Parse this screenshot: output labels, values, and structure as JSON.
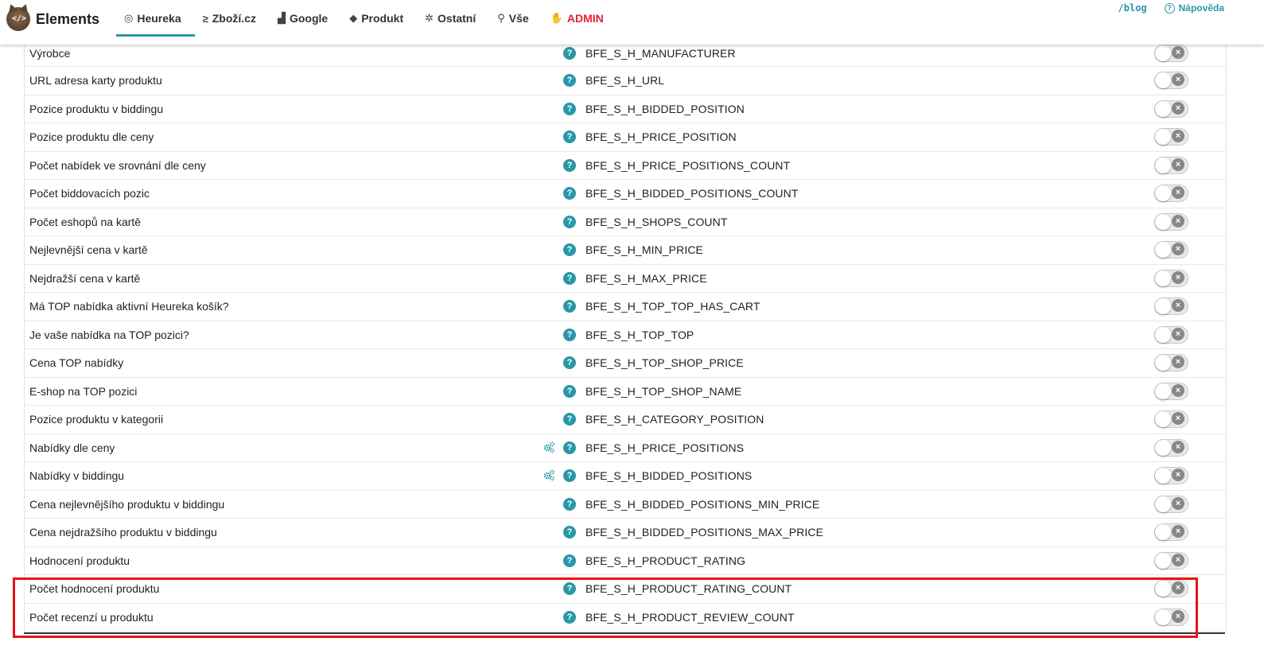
{
  "app": {
    "name": "Elements",
    "logo_text": "</>"
  },
  "nav": [
    {
      "label": "Heureka",
      "icon": "heureka-icon",
      "glyph": "◎",
      "active": true
    },
    {
      "label": "Zboží.cz",
      "icon": "zbozi-icon",
      "glyph": "≥",
      "active": false
    },
    {
      "label": "Google",
      "icon": "bar-chart-icon",
      "glyph": "▟",
      "active": false
    },
    {
      "label": "Produkt",
      "icon": "tag-icon",
      "glyph": "◆",
      "active": false
    },
    {
      "label": "Ostatní",
      "icon": "gear-outline-icon",
      "glyph": "✲",
      "active": false
    },
    {
      "label": "Vše",
      "icon": "search-icon",
      "glyph": "⚲",
      "active": false
    },
    {
      "label": "ADMIN",
      "icon": "hand-icon",
      "glyph": "✋",
      "active": false,
      "color": "#e3232f"
    }
  ],
  "top_right": {
    "blog": "/blog",
    "help": "Nápověda",
    "help_glyph": "?"
  },
  "colors": {
    "accent": "#2a97a6",
    "admin": "#e3232f",
    "highlight": "#ee1111"
  },
  "rows": [
    {
      "label": "Výrobce",
      "code": "BFE_S_H_MANUFACTURER",
      "gear": false,
      "enabled": false
    },
    {
      "label": "URL adresa karty produktu",
      "code": "BFE_S_H_URL",
      "gear": false,
      "enabled": false
    },
    {
      "label": "Pozice produktu v biddingu",
      "code": "BFE_S_H_BIDDED_POSITION",
      "gear": false,
      "enabled": false
    },
    {
      "label": "Pozice produktu dle ceny",
      "code": "BFE_S_H_PRICE_POSITION",
      "gear": false,
      "enabled": false
    },
    {
      "label": "Počet nabídek ve srovnání dle ceny",
      "code": "BFE_S_H_PRICE_POSITIONS_COUNT",
      "gear": false,
      "enabled": false
    },
    {
      "label": "Počet biddovacích pozic",
      "code": "BFE_S_H_BIDDED_POSITIONS_COUNT",
      "gear": false,
      "enabled": false
    },
    {
      "label": "Počet eshopů na kartě",
      "code": "BFE_S_H_SHOPS_COUNT",
      "gear": false,
      "enabled": false
    },
    {
      "label": "Nejlevnější cena v kartě",
      "code": "BFE_S_H_MIN_PRICE",
      "gear": false,
      "enabled": false
    },
    {
      "label": "Nejdražší cena v kartě",
      "code": "BFE_S_H_MAX_PRICE",
      "gear": false,
      "enabled": false
    },
    {
      "label": "Má TOP nabídka aktivní Heureka košík?",
      "code": "BFE_S_H_TOP_TOP_HAS_CART",
      "gear": false,
      "enabled": false
    },
    {
      "label": "Je vaše nabídka na TOP pozici?",
      "code": "BFE_S_H_TOP_TOP",
      "gear": false,
      "enabled": false
    },
    {
      "label": "Cena TOP nabídky",
      "code": "BFE_S_H_TOP_SHOP_PRICE",
      "gear": false,
      "enabled": false
    },
    {
      "label": "E-shop na TOP pozici",
      "code": "BFE_S_H_TOP_SHOP_NAME",
      "gear": false,
      "enabled": false
    },
    {
      "label": "Pozice produktu v kategorii",
      "code": "BFE_S_H_CATEGORY_POSITION",
      "gear": false,
      "enabled": false
    },
    {
      "label": "Nabídky dle ceny",
      "code": "BFE_S_H_PRICE_POSITIONS",
      "gear": true,
      "enabled": false
    },
    {
      "label": "Nabídky v biddingu",
      "code": "BFE_S_H_BIDDED_POSITIONS",
      "gear": true,
      "enabled": false
    },
    {
      "label": "Cena nejlevnějšího produktu v biddingu",
      "code": "BFE_S_H_BIDDED_POSITIONS_MIN_PRICE",
      "gear": false,
      "enabled": false
    },
    {
      "label": "Cena nejdražšího produktu v biddingu",
      "code": "BFE_S_H_BIDDED_POSITIONS_MAX_PRICE",
      "gear": false,
      "enabled": false
    },
    {
      "label": "Hodnocení produktu",
      "code": "BFE_S_H_PRODUCT_RATING",
      "gear": false,
      "enabled": false
    },
    {
      "label": "Počet hodnocení produktu",
      "code": "BFE_S_H_PRODUCT_RATING_COUNT",
      "gear": false,
      "enabled": false,
      "highlighted": true
    },
    {
      "label": "Počet recenzí u produktu",
      "code": "BFE_S_H_PRODUCT_REVIEW_COUNT",
      "gear": false,
      "enabled": false,
      "highlighted": true
    }
  ],
  "icons": {
    "help": "?",
    "toggle_off": "×"
  }
}
